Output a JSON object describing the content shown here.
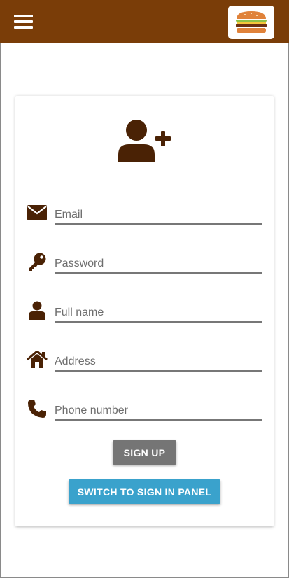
{
  "header": {
    "menu_icon": "hamburger-menu-icon",
    "logo_icon": "burger-logo-icon",
    "bar_color": "#7a3d08"
  },
  "form": {
    "header_icon": "add-user-icon",
    "fields": [
      {
        "icon": "envelope-icon",
        "placeholder": "Email"
      },
      {
        "icon": "key-icon",
        "placeholder": "Password"
      },
      {
        "icon": "person-icon",
        "placeholder": "Full name"
      },
      {
        "icon": "home-icon",
        "placeholder": "Address"
      },
      {
        "icon": "phone-icon",
        "placeholder": "Phone number"
      }
    ],
    "signup_label": "SIGN UP",
    "switch_label": "SWITCH TO SIGN IN PANEL"
  },
  "colors": {
    "icon": "#4a2205",
    "signup_button": "#757575",
    "switch_button": "#3aa2cc"
  }
}
